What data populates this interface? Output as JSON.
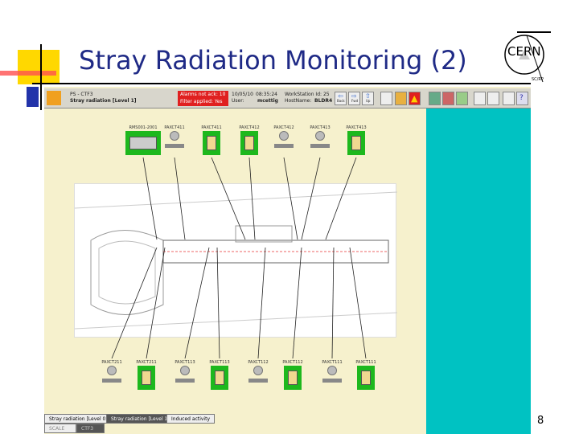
{
  "slide": {
    "title": "Stray Radiation Monitoring (2)",
    "page_number": "8",
    "logo_text": "CERN",
    "logo_sub": "SC/RP"
  },
  "toolbar": {
    "area": "PS - CTF3",
    "view": "Stray radiation [Level 1]",
    "alarms": "Alarms not ack: 10",
    "filter": "Filter applied: Yes",
    "date": "10/05/10",
    "time": "08:35:24",
    "user_label": "User:",
    "user": "mcettig",
    "ws": "WorkStation Id: 25",
    "host_label": "HostName:",
    "host": "BLDR4",
    "back": "Back",
    "fwd": "Fwd",
    "up": "Up"
  },
  "top_devices": [
    {
      "label": "RMS001-2001",
      "type": "rms"
    },
    {
      "label": "PAXCT411",
      "type": "gauge"
    },
    {
      "label": "PAXCT411",
      "type": "green"
    },
    {
      "label": "PAXCT412",
      "type": "green"
    },
    {
      "label": "PAXCT412",
      "type": "gauge"
    },
    {
      "label": "PAXCT413",
      "type": "gauge"
    },
    {
      "label": "PAXCT413",
      "type": "green"
    }
  ],
  "bottom_devices": [
    {
      "label": "PAXCT211",
      "type": "gauge"
    },
    {
      "label": "PAXCT211",
      "type": "green"
    },
    {
      "label": "PAXCT113",
      "type": "gauge"
    },
    {
      "label": "PAXCT113",
      "type": "green"
    },
    {
      "label": "PAXCT112",
      "type": "gauge"
    },
    {
      "label": "PAXCT112",
      "type": "green"
    },
    {
      "label": "PAXCT111",
      "type": "gauge"
    },
    {
      "label": "PAXCT111",
      "type": "green"
    }
  ],
  "tabs": [
    "Stray radiation [Level 0]",
    "Stray radiation [Level 1]",
    "Induced activity"
  ],
  "subtabs": [
    "SCALE",
    "CTF3"
  ]
}
